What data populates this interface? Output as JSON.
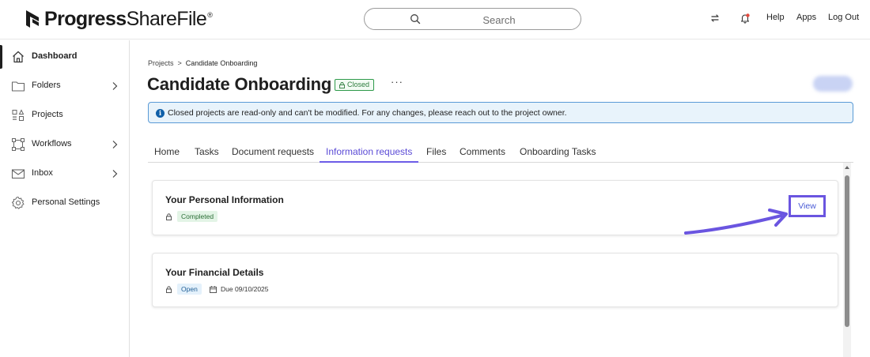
{
  "app": {
    "logo_bold": "Progress",
    "logo_light": "ShareFile",
    "logo_reg": "®"
  },
  "header": {
    "search_placeholder": "Search",
    "links": {
      "help": "Help",
      "apps": "Apps",
      "logout": "Log Out"
    }
  },
  "sidebar": {
    "items": [
      {
        "label": "Dashboard",
        "icon": "home-icon",
        "active": true
      },
      {
        "label": "Folders",
        "icon": "folder-icon",
        "has_chevron": true
      },
      {
        "label": "Projects",
        "icon": "projects-icon"
      },
      {
        "label": "Workflows",
        "icon": "workflows-icon",
        "has_chevron": true
      },
      {
        "label": "Inbox",
        "icon": "inbox-icon",
        "has_chevron": true
      },
      {
        "label": "Personal Settings",
        "icon": "gear-icon"
      }
    ]
  },
  "breadcrumb": {
    "parent": "Projects",
    "separator": ">",
    "current": "Candidate Onboarding"
  },
  "page": {
    "title": "Candidate Onboarding",
    "status": "Closed",
    "more": "···"
  },
  "alert": {
    "icon_glyph": "i",
    "text": "Closed projects are read-only and can't be modified. For any changes, please reach out to the project owner."
  },
  "tabs": [
    {
      "label": "Home"
    },
    {
      "label": "Tasks"
    },
    {
      "label": "Document requests"
    },
    {
      "label": "Information requests",
      "active": true
    },
    {
      "label": "Files"
    },
    {
      "label": "Comments"
    },
    {
      "label": "Onboarding Tasks"
    }
  ],
  "requests": [
    {
      "title": "Your Personal Information",
      "status": "Completed",
      "action": "View"
    },
    {
      "title": "Your Financial Details",
      "status": "Open",
      "due": "Due 09/10/2025"
    }
  ],
  "colors": {
    "accent": "#6c5ce7",
    "alert_border": "#5a9ad6",
    "alert_bg": "#e8f3fb",
    "closed_badge": "#2e9a4a",
    "completed_bg": "#e3f4e6",
    "open_bg": "#e4f1fb"
  }
}
